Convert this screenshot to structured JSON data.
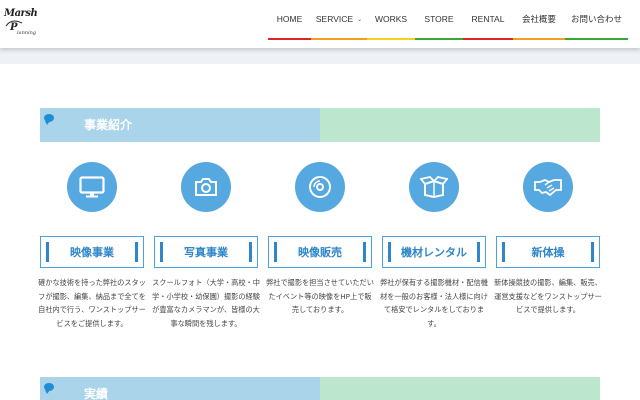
{
  "logo": {
    "line1": "Marsh",
    "line2": "P",
    "line3": "lanning"
  },
  "nav": {
    "items": [
      {
        "label": "HOME"
      },
      {
        "label": "SERVICE"
      },
      {
        "label": "WORKS"
      },
      {
        "label": "STORE"
      },
      {
        "label": "RENTAL"
      },
      {
        "label": "会社概要"
      },
      {
        "label": "お問い合わせ"
      }
    ],
    "underline_colors": [
      "#d9262b",
      "#f0a020",
      "#f2d21b",
      "#3aa63a",
      "#d9262b",
      "#f0a020",
      "#3aa63a"
    ]
  },
  "section1": {
    "title": "事業紹介"
  },
  "section2": {
    "title": "実績"
  },
  "services": [
    {
      "icon": "monitor-icon",
      "label": "映像事業",
      "desc": "確かな技術を持った弊社のスタッフが撮影、編集、納品まで全てを自社内で行う、ワンストップサービスをご提供します。"
    },
    {
      "icon": "camera-icon",
      "label": "写真事業",
      "desc": "スクールフォト（大学・高校・中学・小学校・幼保園）撮影の経験が豊富なカメラマンが、皆様の大事な瞬間を残します。"
    },
    {
      "icon": "disc-icon",
      "label": "映像販売",
      "desc": "弊社で撮影を担当させていただいたイベント等の映像をHP上で販売しております。"
    },
    {
      "icon": "box-icon",
      "label": "機材レンタル",
      "desc": "弊社が保有する撮影機材・配信機材を一般のお客様・法人様に向けて格安でレンタルをしております。"
    },
    {
      "icon": "handshake-icon",
      "label": "新体操",
      "desc": "新体操競技の撮影、編集、販売、運営支援などをワンストップサービスで提供します。"
    }
  ],
  "colors": {
    "band_left": "#a9d4ea",
    "band_right": "#bde6cf",
    "icon_circle": "#55a8e0",
    "accent": "#2f86c8"
  }
}
